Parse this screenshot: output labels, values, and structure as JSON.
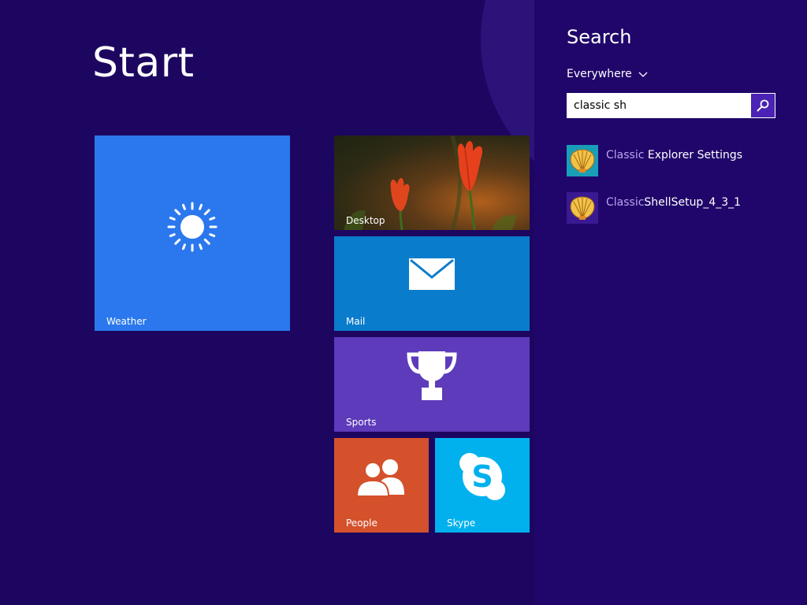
{
  "start": {
    "title": "Start"
  },
  "tiles": {
    "weather": {
      "label": "Weather"
    },
    "desktop": {
      "label": "Desktop"
    },
    "mail": {
      "label": "Mail"
    },
    "sports": {
      "label": "Sports"
    },
    "people": {
      "label": "People"
    },
    "skype": {
      "label": "Skype"
    }
  },
  "search": {
    "title": "Search",
    "scope": "Everywhere",
    "query": "classic sh",
    "results": [
      {
        "highlight": "Classic",
        "rest": " Explorer Settings",
        "icon": "classic-shell-icon"
      },
      {
        "highlight": "Classic",
        "rest": "ShellSetup_4_3_1",
        "icon": "classic-shell-icon"
      }
    ]
  },
  "colors": {
    "start_bg": "#1d0660",
    "charm_bg": "#20066a",
    "weather": "#2b78ee",
    "mail": "#0a7ccc",
    "sports": "#5d3bbb",
    "people": "#d4512c",
    "skype": "#00b1ed",
    "match_highlight": "#b8a4f2"
  }
}
